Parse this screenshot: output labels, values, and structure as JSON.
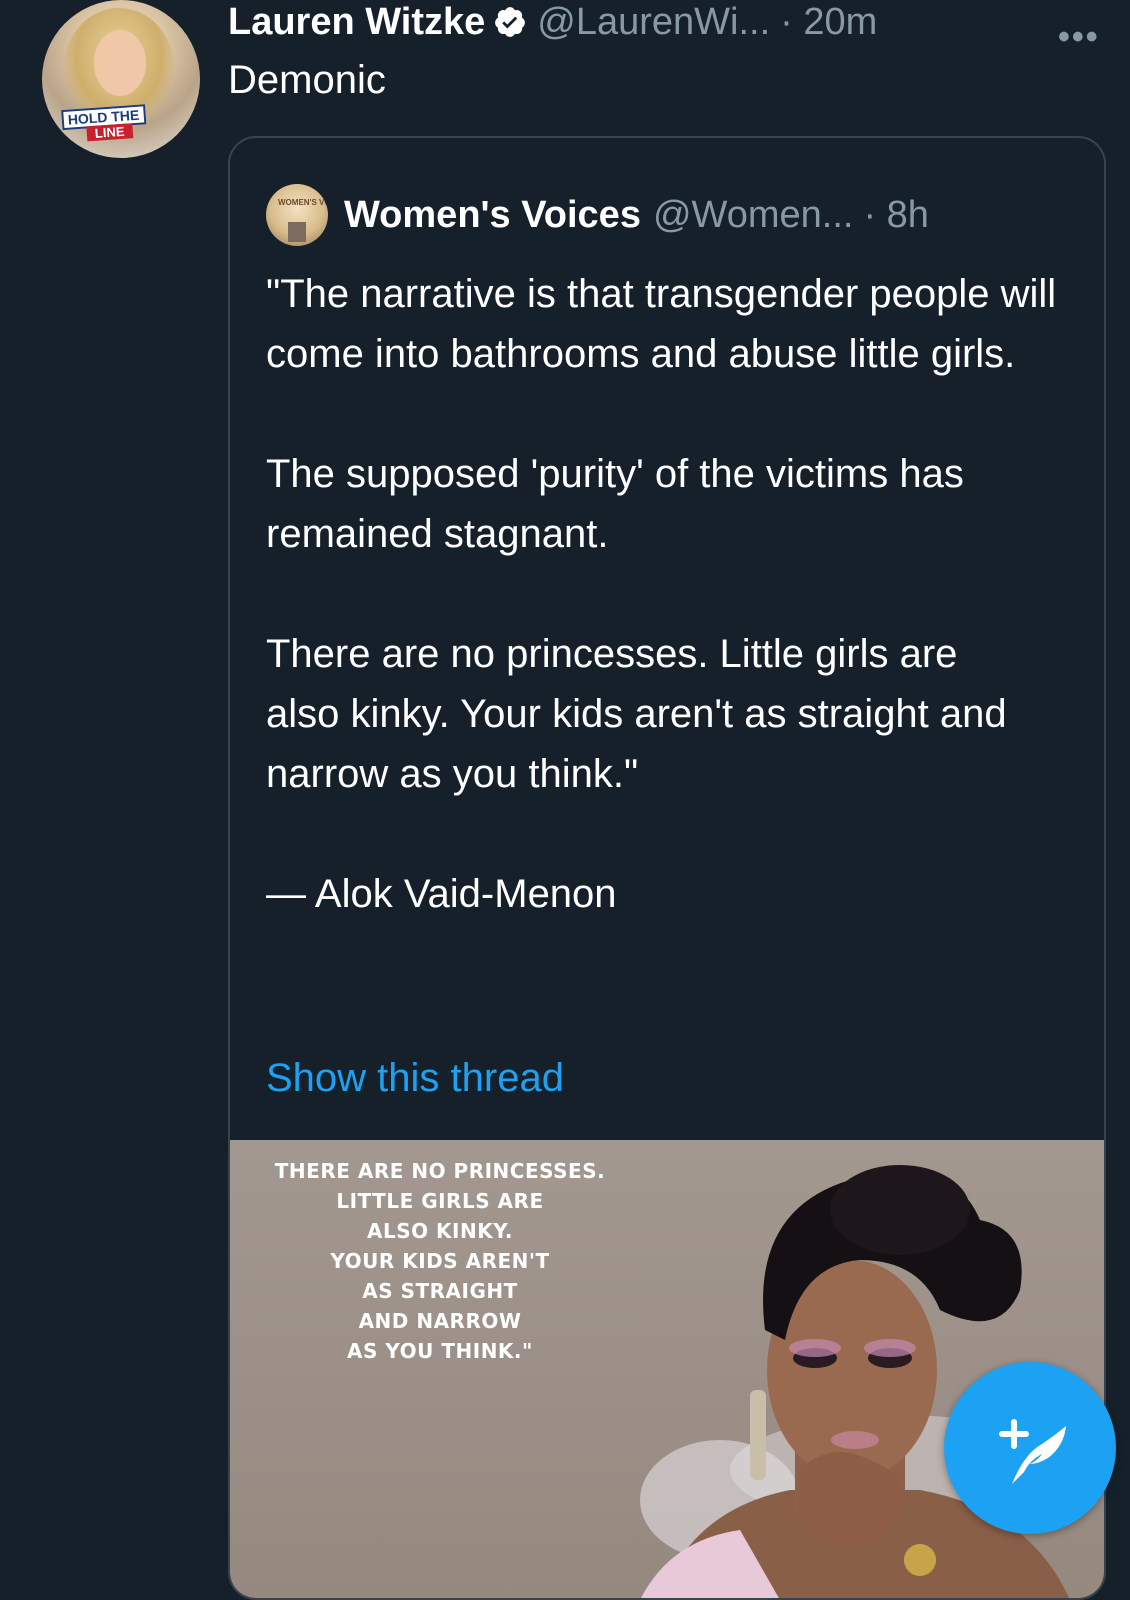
{
  "tweet": {
    "author_name": "Lauren Witzke",
    "author_handle": "@LaurenWi...",
    "time": "· 20m",
    "more_icon": "more-dots-icon",
    "verified_icon": "verified-badge-icon",
    "avatar_text_top": "HOLD THE",
    "avatar_text_bottom": "LINE",
    "text": "Demonic"
  },
  "quote": {
    "author_name": "Women's Voices",
    "author_handle": "@Women...",
    "time": "· 8h",
    "avatar_text": "WOMEN'S VOICES",
    "paragraphs": [
      "\"The narrative is that transgender people will come into bathrooms and abuse little girls.",
      "The supposed 'purity' of the victims has remained stagnant.",
      "There are no princesses. Little girls are",
      "also kinky. Your kids aren't as straight and narrow as you think.\"",
      "— Alok Vaid-Menon"
    ],
    "show_thread": "Show this thread",
    "media_caption_lines": [
      "THERE ARE NO PRINCESSES.",
      "LITTLE GIRLS ARE",
      "ALSO KINKY.",
      "YOUR KIDS AREN'T",
      "AS STRAIGHT",
      "AND NARROW",
      "AS YOU THINK.\""
    ]
  },
  "compose_button": {
    "icon": "compose-tweet-icon",
    "color": "#1da1f2"
  },
  "colors": {
    "background": "#15202b",
    "muted": "#8899a6",
    "link": "#1da1f2",
    "border": "#38444d"
  }
}
